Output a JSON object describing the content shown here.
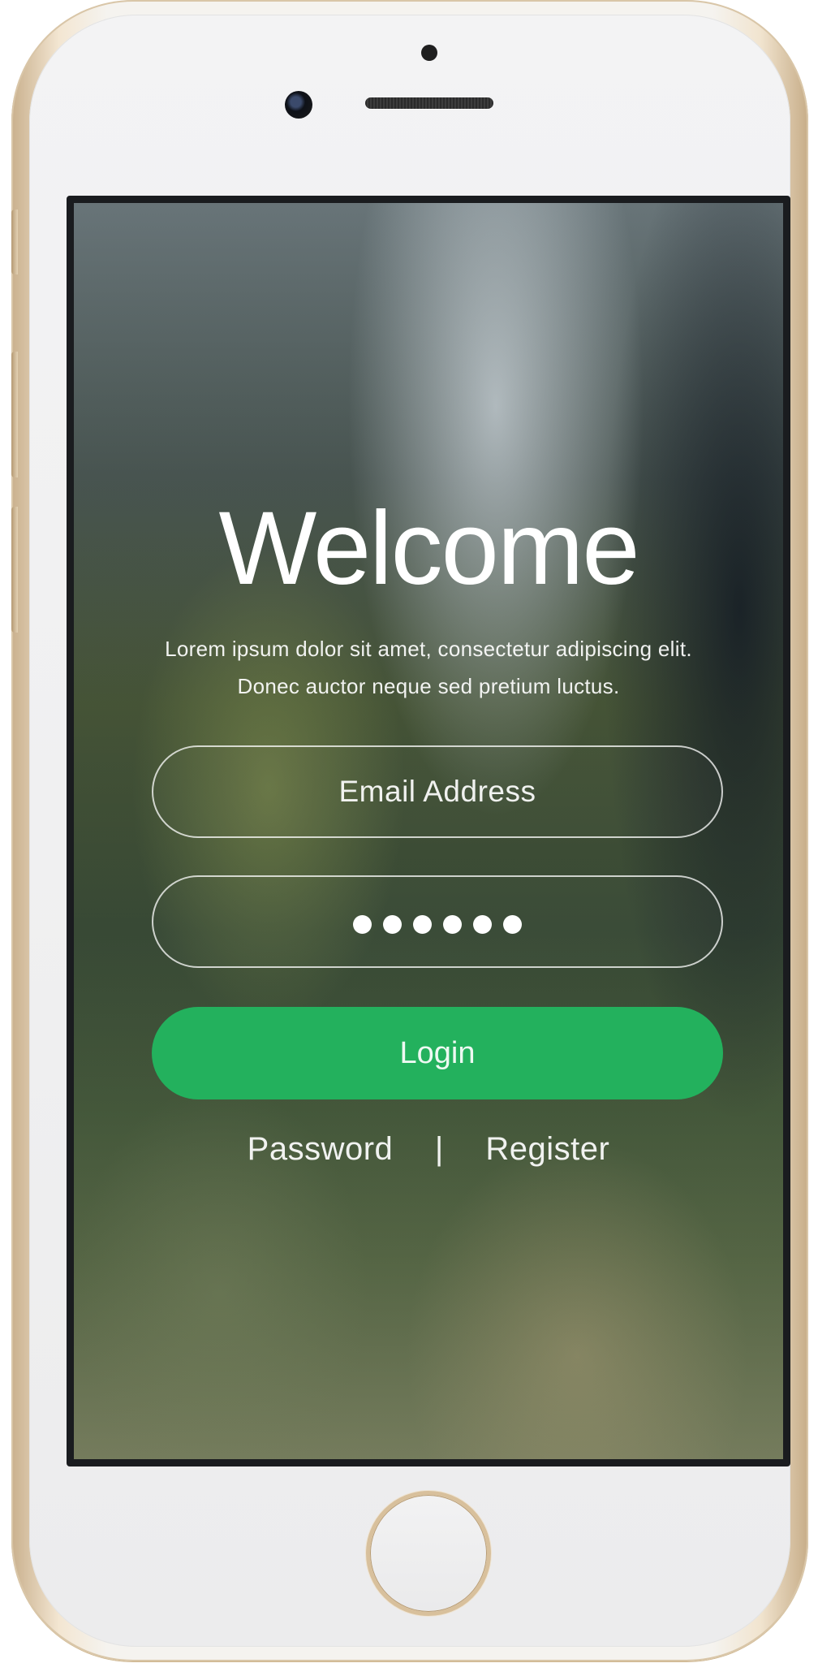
{
  "screen": {
    "title": "Welcome",
    "subtitle_line1": "Lorem ipsum dolor sit amet, consectetur adipiscing elit.",
    "subtitle_line2": "Donec auctor neque sed pretium luctus.",
    "email_placeholder": "Email Address",
    "password_masked_count": 6,
    "login_label": "Login",
    "password_link": "Password",
    "separator": "|",
    "register_link": "Register"
  },
  "colors": {
    "login_button": "#23b15d",
    "text": "#ffffff",
    "device_frame": "#f5f3ef",
    "device_trim": "#d8c09c"
  },
  "icons": {
    "front_camera": "camera-icon",
    "home": "home-button"
  }
}
